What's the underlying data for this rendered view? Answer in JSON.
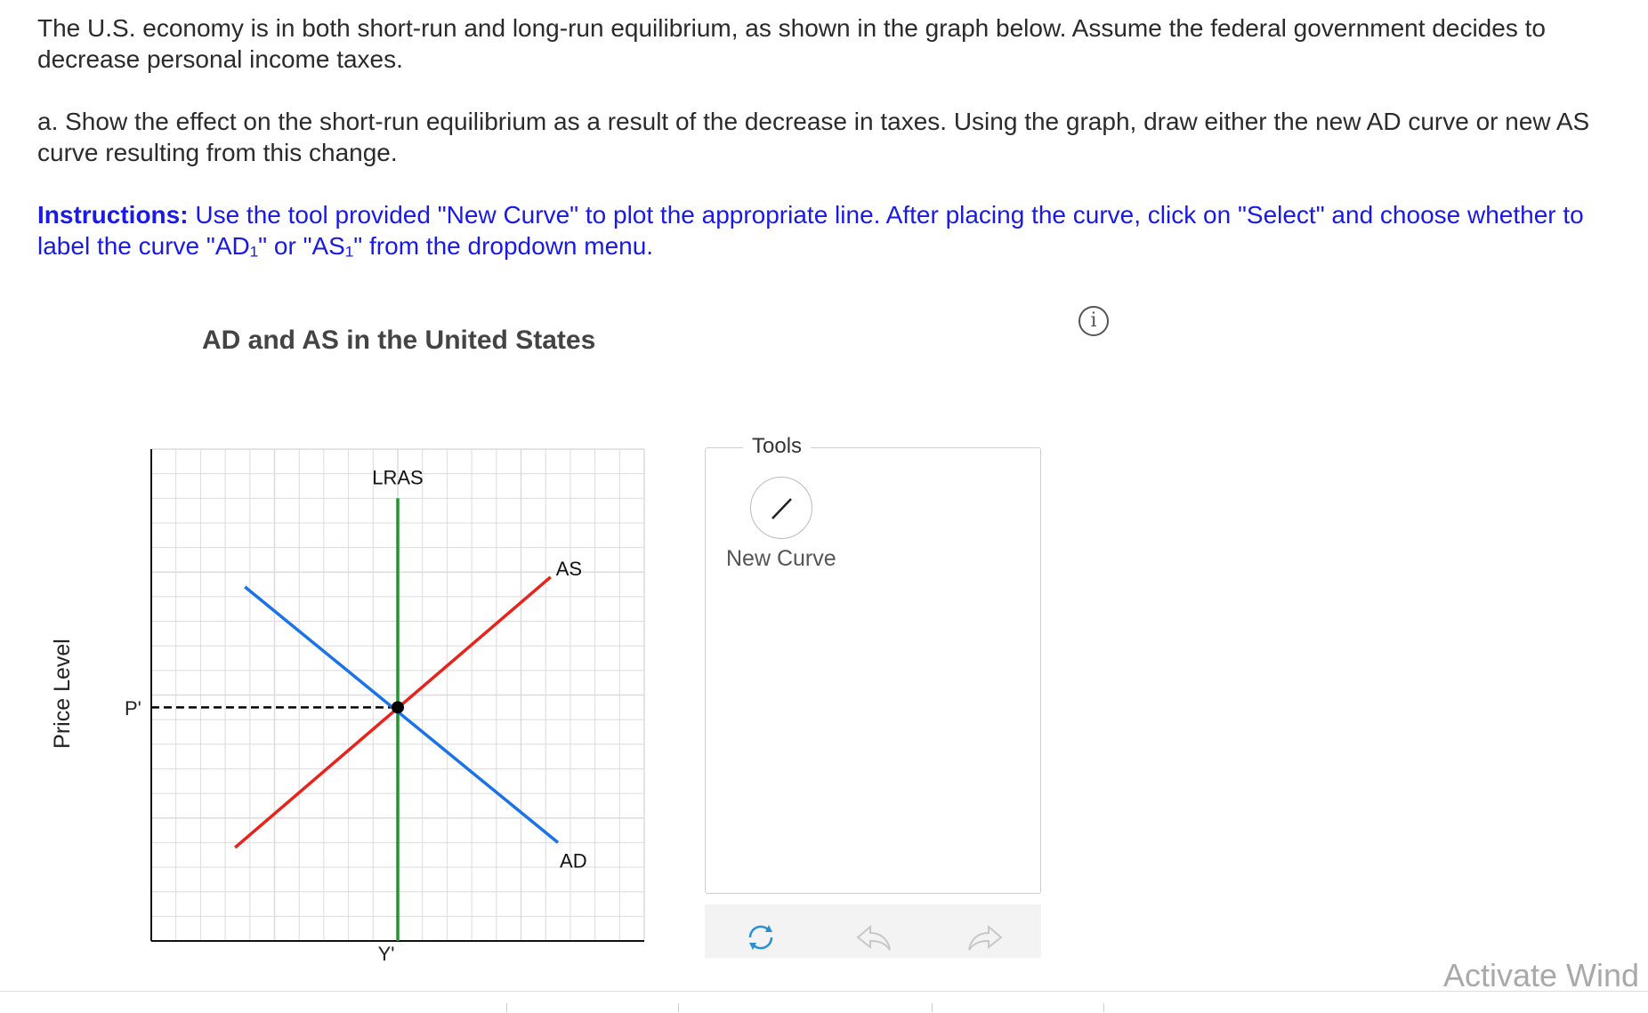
{
  "question": {
    "intro": "The U.S. economy is in both short-run and long-run equilibrium, as shown in the graph below. Assume the federal government decides to decrease personal income taxes.",
    "part_a": "a. Show the effect on the short-run equilibrium as a result of the decrease in taxes. Using the graph, draw either the new AD curve or new AS curve resulting from this change.",
    "instructions_label": "Instructions:",
    "instructions_text": " Use the tool provided \"New Curve\" to plot the appropriate line. After placing the curve, click on \"Select\" and choose whether to label the curve \"AD₁\" or \"AS₁\" from the dropdown menu."
  },
  "chart": {
    "title": "AD and AS in the United States",
    "y_axis_label": "Price Level",
    "p_label": "P'",
    "y_label": "Y'"
  },
  "chart_data": {
    "type": "line",
    "title": "AD and AS in the United States",
    "ylabel": "Price Level",
    "xlim": [
      0,
      20
    ],
    "ylim": [
      0,
      20
    ],
    "grid": true,
    "series": [
      {
        "name": "LRAS",
        "color": "#22962b",
        "x": [
          10,
          10
        ],
        "y": [
          0,
          18
        ]
      },
      {
        "name": "AS",
        "color": "#e8231c",
        "x": [
          3.4,
          16.2
        ],
        "y": [
          3.8,
          14.8
        ]
      },
      {
        "name": "AD",
        "color": "#1a73e8",
        "x": [
          3.8,
          16.5
        ],
        "y": [
          14.4,
          4
        ]
      }
    ],
    "equilibrium": {
      "label": "P'",
      "x": 10,
      "y": 9.5
    }
  },
  "tools": {
    "legend": "Tools",
    "new_curve_label": "New Curve"
  },
  "toolbar": {
    "reset_icon": "refresh-icon",
    "undo_icon": "undo-icon",
    "redo_icon": "redo-icon"
  },
  "watermark": "Activate Wind",
  "colors": {
    "instructions": "#1a1ae6",
    "lras": "#22962b",
    "as": "#e8231c",
    "ad": "#1a73e8"
  }
}
